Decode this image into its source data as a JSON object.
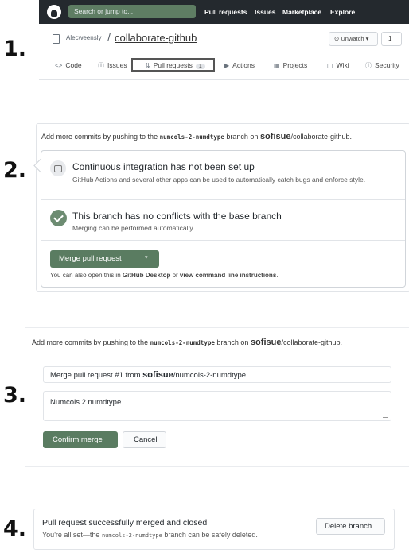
{
  "steps": [
    "1.",
    "2.",
    "3.",
    "4."
  ],
  "panel1": {
    "search_placeholder": "Search or jump to...",
    "nav": [
      "Pull requests",
      "Issues",
      "Marketplace",
      "Explore"
    ],
    "repo_owner": "Alecweensly",
    "repo_slash": "/",
    "repo_name": "collaborate-github",
    "watch_label": "⊙ Unwatch ▾",
    "watch_count": "1",
    "tabs": [
      {
        "icon": "<>",
        "label": "Code"
      },
      {
        "icon": "ⓘ",
        "label": "Issues"
      },
      {
        "icon": "⇅",
        "label": "Pull requests",
        "badge": "1"
      },
      {
        "icon": "▶",
        "label": "Actions"
      },
      {
        "icon": "▦",
        "label": "Projects"
      },
      {
        "icon": "▢",
        "label": "Wiki"
      },
      {
        "icon": "ⓘ",
        "label": "Security"
      }
    ]
  },
  "panel2": {
    "intro_prefix": "Add more commits by pushing to the",
    "branch": "numcols-2-numdtype",
    "intro_mid": "branch on",
    "owner": "sofisue",
    "repo": "/collaborate-github.",
    "ci_title": "Continuous integration has not been set up",
    "ci_desc": "GitHub Actions and several other apps can be used to automatically catch bugs and enforce style.",
    "nc_title": "This branch has no conflicts with the base branch",
    "nc_desc": "Merging can be performed automatically.",
    "merge_button": "Merge pull request",
    "merge_caret": "▾",
    "note_a": "You can also open this in ",
    "note_b": "GitHub Desktop",
    "note_c": " or ",
    "note_d": "view command line instructions",
    "note_e": "."
  },
  "panel3": {
    "intro_prefix": "Add more commits by pushing to the",
    "branch": "numcols-2-numdtype",
    "intro_mid": "branch on",
    "owner": "sofisue",
    "repo": "/collaborate-github.",
    "title_prefix": "Merge pull request #1 from",
    "title_owner": "sofisue",
    "title_suffix": "/numcols-2-numdtype",
    "body_value": "Numcols 2 numdtype",
    "confirm_button": "Confirm merge",
    "cancel_button": "Cancel"
  },
  "panel4": {
    "title": "Pull request successfully merged and closed",
    "desc_prefix": "You're all set—the",
    "branch": "numcols-2-numdtype",
    "desc_suffix": "branch can be safely deleted.",
    "delete_button": "Delete branch"
  },
  "colors": {
    "merge_green": "#5a7c61",
    "topbar": "#24292e",
    "search_green": "#5e7d63"
  }
}
